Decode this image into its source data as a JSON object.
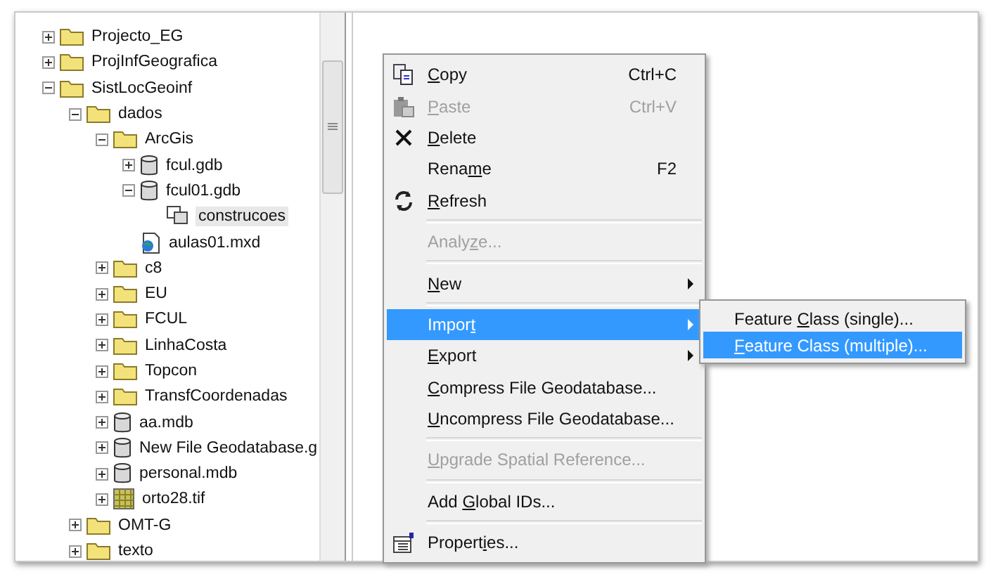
{
  "tree": {
    "items": [
      {
        "label": "Projecto_EG",
        "kind": "folder",
        "expanded": false,
        "selected": false
      },
      {
        "label": "ProjInfGeografica",
        "kind": "folder",
        "expanded": false,
        "selected": false
      },
      {
        "label": "SistLocGeoinf",
        "kind": "folder",
        "expanded": true,
        "selected": false,
        "children": [
          {
            "label": "dados",
            "kind": "folder",
            "expanded": true,
            "selected": false,
            "children": [
              {
                "label": "ArcGis",
                "kind": "folder",
                "expanded": true,
                "selected": false,
                "children": [
                  {
                    "label": "fcul.gdb",
                    "kind": "database",
                    "expanded": false,
                    "selected": false
                  },
                  {
                    "label": "fcul01.gdb",
                    "kind": "database",
                    "expanded": true,
                    "selected": false,
                    "children": [
                      {
                        "label": "construcoes",
                        "kind": "featureclass",
                        "selected": true
                      }
                    ]
                  },
                  {
                    "label": "aulas01.mxd",
                    "kind": "map",
                    "selected": false
                  }
                ]
              },
              {
                "label": "c8",
                "kind": "folder",
                "expanded": false,
                "selected": false
              },
              {
                "label": "EU",
                "kind": "folder",
                "expanded": false,
                "selected": false
              },
              {
                "label": "FCUL",
                "kind": "folder",
                "expanded": false,
                "selected": false
              },
              {
                "label": "LinhaCosta",
                "kind": "folder",
                "expanded": false,
                "selected": false
              },
              {
                "label": "Topcon",
                "kind": "folder",
                "expanded": false,
                "selected": false
              },
              {
                "label": "TransfCoordenadas",
                "kind": "folder",
                "expanded": false,
                "selected": false
              },
              {
                "label": "aa.mdb",
                "kind": "database",
                "expanded": false,
                "selected": false
              },
              {
                "label": "New File Geodatabase.g",
                "kind": "database",
                "expanded": false,
                "selected": false
              },
              {
                "label": "personal.mdb",
                "kind": "database",
                "expanded": false,
                "selected": false
              },
              {
                "label": "orto28.tif",
                "kind": "raster",
                "expanded": false,
                "selected": false
              }
            ]
          },
          {
            "label": "OMT-G",
            "kind": "folder",
            "expanded": false,
            "selected": false
          },
          {
            "label": "texto",
            "kind": "folder",
            "expanded": false,
            "selected": false
          }
        ]
      }
    ]
  },
  "context_menu": {
    "items": [
      {
        "kind": "item",
        "label": "Copy",
        "shortcut": "Ctrl+C",
        "disabled": false,
        "selected": false
      },
      {
        "kind": "item",
        "label": "Paste",
        "shortcut": "Ctrl+V",
        "disabled": true,
        "selected": false
      },
      {
        "kind": "item",
        "label": "Delete",
        "disabled": false,
        "selected": false
      },
      {
        "kind": "item",
        "label": "Rename",
        "shortcut": "F2",
        "disabled": false,
        "selected": false
      },
      {
        "kind": "item",
        "label": "Refresh",
        "disabled": false,
        "selected": false
      },
      {
        "kind": "separator"
      },
      {
        "kind": "item",
        "label": "Analyze...",
        "disabled": true,
        "selected": false
      },
      {
        "kind": "separator"
      },
      {
        "kind": "item",
        "label": "New",
        "submenu": true,
        "disabled": false,
        "selected": false
      },
      {
        "kind": "separator"
      },
      {
        "kind": "item",
        "label": "Import",
        "submenu": true,
        "disabled": false,
        "selected": true
      },
      {
        "kind": "item",
        "label": "Export",
        "submenu": true,
        "disabled": false,
        "selected": false
      },
      {
        "kind": "item",
        "label": "Compress File Geodatabase...",
        "disabled": false,
        "selected": false
      },
      {
        "kind": "item",
        "label": "Uncompress File Geodatabase...",
        "disabled": false,
        "selected": false
      },
      {
        "kind": "separator"
      },
      {
        "kind": "item",
        "label": "Upgrade Spatial Reference...",
        "disabled": true,
        "selected": false
      },
      {
        "kind": "separator"
      },
      {
        "kind": "item",
        "label": "Add Global IDs...",
        "disabled": false,
        "selected": false
      },
      {
        "kind": "separator"
      },
      {
        "kind": "item",
        "label": "Properties...",
        "disabled": false,
        "selected": false
      }
    ]
  },
  "submenu": {
    "items": [
      {
        "label": "Feature Class (single)...",
        "selected": false
      },
      {
        "label": "Feature Class (multiple)...",
        "selected": true
      }
    ]
  }
}
